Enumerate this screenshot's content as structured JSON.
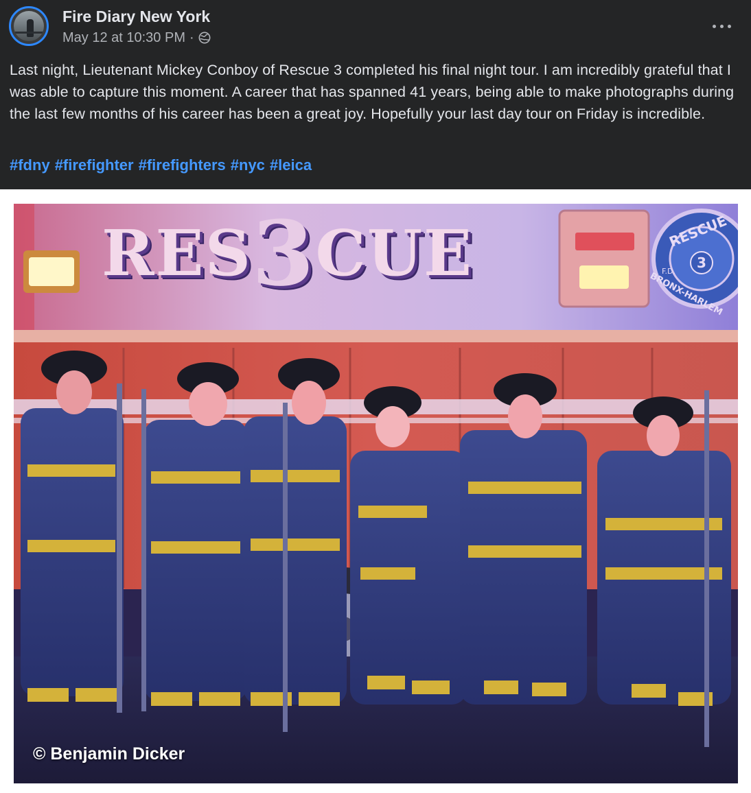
{
  "post": {
    "page_name": "Fire Diary New York",
    "timestamp": "May 12 at 10:30 PM",
    "separator": "·",
    "privacy_icon": "globe-icon",
    "more_icon": "more-options-icon",
    "body": "Last night, Lieutenant Mickey Conboy of Rescue 3 completed his final night tour. I am incredibly grateful that I was able to capture this moment. A career that has spanned 41 years, being able to make photographs during the last few months of his career has been a great joy. Hopefully your last day tour on Friday is incredible.",
    "hashtags": [
      "#fdny",
      "#firefighter",
      "#firefighters",
      "#nyc",
      "#leica"
    ]
  },
  "photo": {
    "truck_lettering_left": "RES",
    "truck_lettering_number": "3",
    "truck_lettering_right": "CUE",
    "badge_top": "RESCUE",
    "badge_bottom": "BRONX-HARLEM",
    "badge_number": "3",
    "badge_side": "F.D.",
    "credit": "© Benjamin Dicker"
  },
  "colors": {
    "header_bg": "#242526",
    "text_primary": "#e4e6eb",
    "text_secondary": "#b0b3b8",
    "hashtag": "#4599ff",
    "avatar_ring": "#2d88ff"
  }
}
